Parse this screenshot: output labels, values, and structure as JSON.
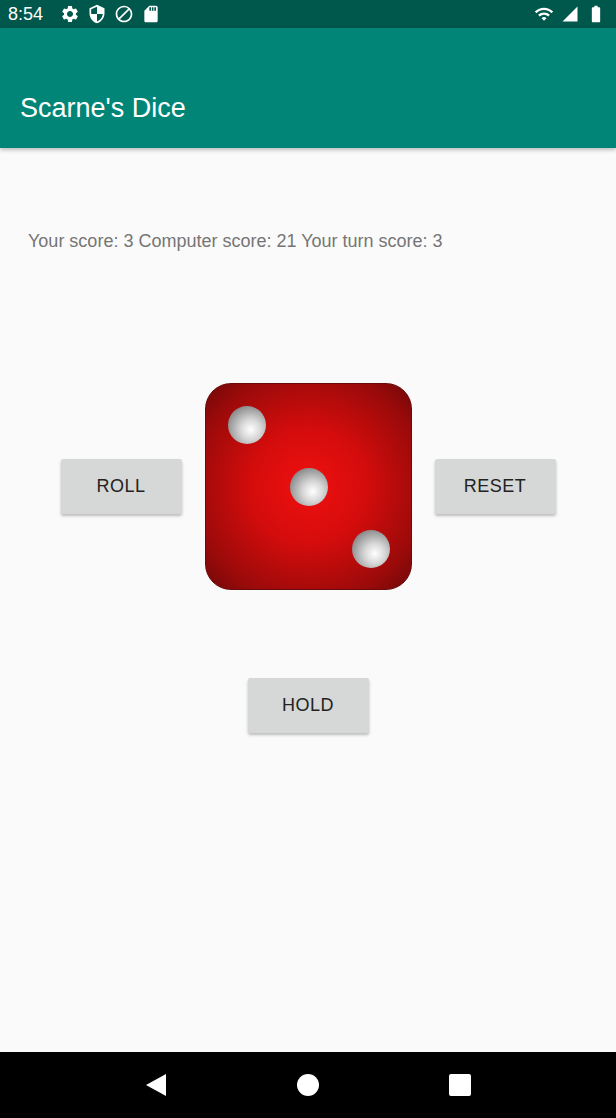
{
  "status_bar": {
    "time": "8:54"
  },
  "app_bar": {
    "title": "Scarne's Dice"
  },
  "score_text": "Your score: 3 Computer score: 21 Your turn score: 3",
  "die": {
    "value": 3
  },
  "buttons": {
    "roll": "ROLL",
    "reset": "RESET",
    "hold": "HOLD"
  }
}
